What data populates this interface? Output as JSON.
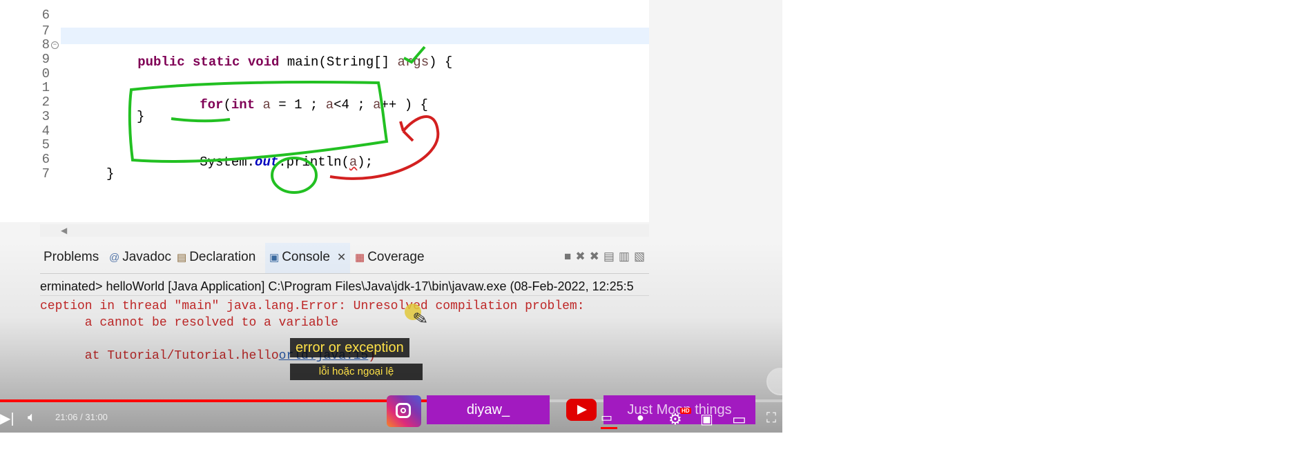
{
  "editor": {
    "lines": [
      {
        "num": "6",
        "code": ""
      },
      {
        "num": "7",
        "code": ""
      },
      {
        "num": "8",
        "code": ""
      },
      {
        "num": "9",
        "code": ""
      },
      {
        "num": "0",
        "code": ""
      },
      {
        "num": "1",
        "code": ""
      },
      {
        "num": "2",
        "code": ""
      },
      {
        "num": "3",
        "code": ""
      },
      {
        "num": "4",
        "code": ""
      },
      {
        "num": "5",
        "code": ""
      },
      {
        "num": "6",
        "code": ""
      },
      {
        "num": "7",
        "code": ""
      }
    ],
    "main_line": {
      "kw1": "public static void",
      "rest": " main(String[] ",
      "var": "args",
      "end": ") {"
    },
    "for_line": {
      "kw": "for",
      "open": "(",
      "kw2": "int",
      "a": " a",
      "rest": " = 1 ; ",
      "a2": "a",
      "rest2": "<4 ; ",
      "a3": "a",
      "rest3": "++ ) {"
    },
    "close_brace": "}",
    "println": {
      "pre": "System.",
      "fld": "out",
      "mid": ".println(",
      "var": "a",
      "end": ");"
    },
    "outer_close": "}"
  },
  "panel": {
    "tabs": {
      "problems": "Problems",
      "javadoc": "Javadoc",
      "declaration": "Declaration",
      "console": "Console",
      "coverage": "Coverage"
    },
    "terminated_line": "erminated> helloWorld [Java Application] C:\\Program Files\\Java\\jdk-17\\bin\\javaw.exe  (08-Feb-2022, 12:25:5",
    "error_lines": {
      "line1": "ception in thread \"main\" java.lang.Error: Unresolved compilation problem:",
      "line2": "      a cannot be resolved to a variable",
      "line3_pre": "      at Tutorial/Tutorial.hello",
      "line3_link": "orld.java:15",
      "line3_end": ")"
    }
  },
  "subtitles": {
    "english": "error or exception",
    "vietnamese": "lỗi hoặc ngoại lệ"
  },
  "player": {
    "time": "21:06 / 31:00",
    "progress_fraction": 0.68,
    "promo_instagram": "diyaw_",
    "promo_youtube": "Just Moon things",
    "hd_badge": "HD",
    "accent_red": "#ff0000",
    "promo_purple": "#a21ac0"
  }
}
